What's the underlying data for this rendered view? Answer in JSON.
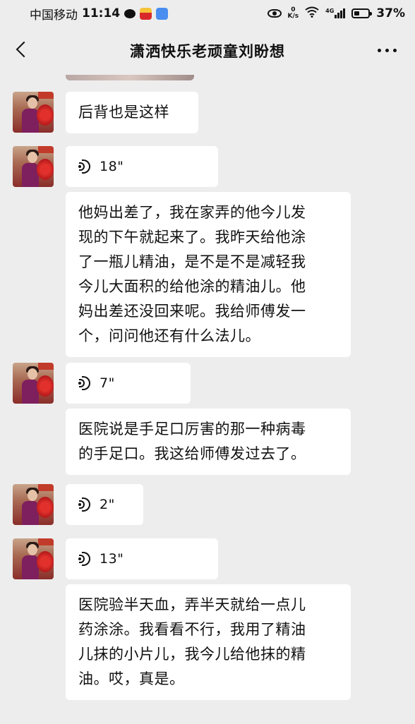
{
  "status_bar": {
    "carrier": "中国移动",
    "time": "11:14",
    "net_speed_value": "0",
    "net_speed_unit": "K/s",
    "network_type": "4G",
    "battery": "37%",
    "battery_level": 0.37
  },
  "header": {
    "title": "潇洒快乐老顽童刘盼想"
  },
  "messages": [
    {
      "type": "text",
      "text": "后背也是这样"
    },
    {
      "type": "voice",
      "duration": "18\""
    },
    {
      "type": "text",
      "lines": [
        "他妈出差了，我在家弄的他今儿发",
        "现的下午就起来了。我昨天给他涂",
        "了一瓶儿精油，是不是不是减轻我",
        "今儿大面积的给他涂的精油儿。他",
        "妈出差还没回来呢。我给师傅发一",
        "个，问问他还有什么法儿。"
      ]
    },
    {
      "type": "voice",
      "duration": "7\""
    },
    {
      "type": "text",
      "lines": [
        "医院说是手足口厉害的那一种病毒",
        "的手足口。我这给师傅发过去了。"
      ]
    },
    {
      "type": "voice",
      "duration": "2\""
    },
    {
      "type": "voice",
      "duration": "13\""
    },
    {
      "type": "text",
      "lines": [
        "医院验半天血，弄半天就给一点儿",
        "药涂涂。我看看不行，我用了精油",
        "儿抹的小片儿，我今儿给他抹的精",
        "油。哎，真是。"
      ]
    }
  ]
}
